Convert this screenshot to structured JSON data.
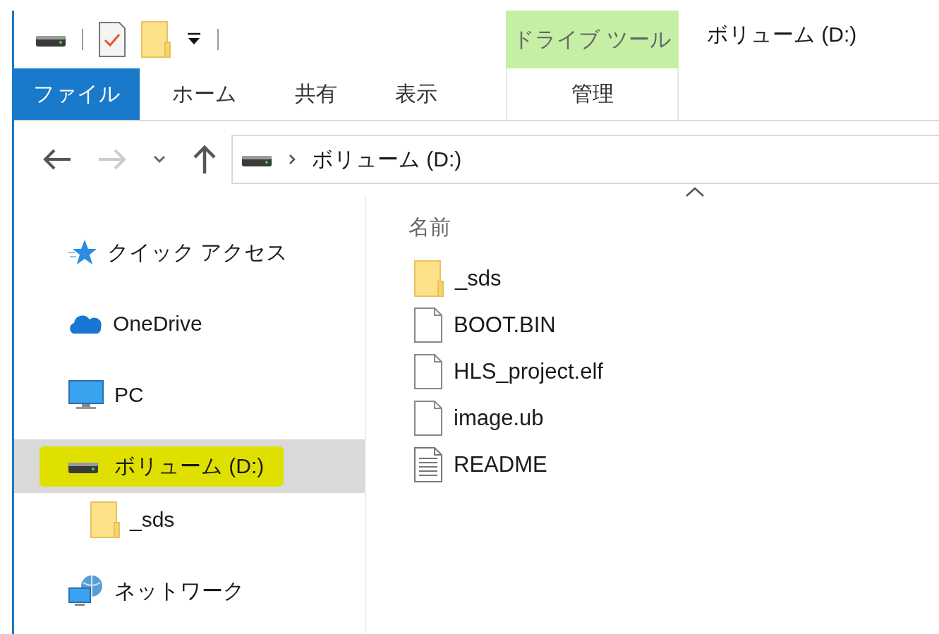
{
  "window": {
    "title": "ボリューム (D:)"
  },
  "ribbon": {
    "tabs": [
      {
        "label": "ファイル",
        "kind": "file",
        "selected": false
      },
      {
        "label": "ホーム",
        "kind": "tab",
        "selected": false
      },
      {
        "label": "共有",
        "kind": "tab",
        "selected": false
      },
      {
        "label": "表示",
        "kind": "tab",
        "selected": false
      }
    ],
    "context_group": {
      "label": "ドライブ ツール",
      "tabs": [
        {
          "label": "管理",
          "selected": false
        }
      ]
    }
  },
  "address_bar": {
    "path": [
      "ボリューム (D:)"
    ]
  },
  "navigation_pane": {
    "items": [
      {
        "label": "クイック アクセス",
        "kind": "star",
        "selected": false,
        "highlighted": false
      },
      {
        "label": "OneDrive",
        "kind": "cloud",
        "selected": false,
        "highlighted": false
      },
      {
        "label": "PC",
        "kind": "pc",
        "selected": false,
        "highlighted": false
      },
      {
        "label": "ボリューム (D:)",
        "kind": "drive",
        "selected": true,
        "highlighted": true,
        "children": [
          {
            "label": "_sds",
            "kind": "folder",
            "selected": false,
            "highlighted": false
          }
        ]
      },
      {
        "label": "ネットワーク",
        "kind": "network",
        "selected": false,
        "highlighted": false
      }
    ]
  },
  "file_list": {
    "columns": [
      {
        "label": "名前",
        "sorted_ascending": true
      }
    ],
    "rows": [
      {
        "name": "_sds",
        "kind": "folder"
      },
      {
        "name": "BOOT.BIN",
        "kind": "file"
      },
      {
        "name": "HLS_project.elf",
        "kind": "file"
      },
      {
        "name": "image.ub",
        "kind": "file"
      },
      {
        "name": "README",
        "kind": "text"
      }
    ]
  }
}
